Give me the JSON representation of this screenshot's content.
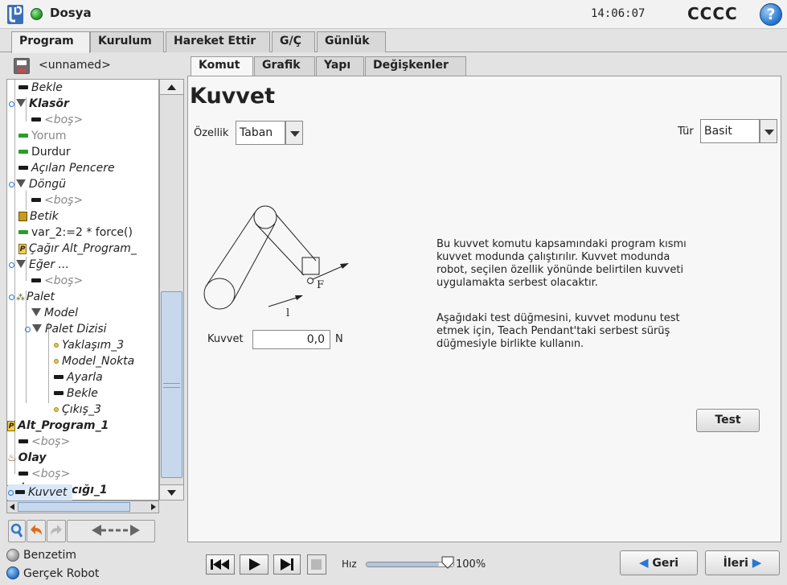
{
  "header": {
    "file_title": "Dosya",
    "clock": "14:06:07",
    "robot_name": "CCCC",
    "help": "?"
  },
  "main_tabs": [
    {
      "label": "Program"
    },
    {
      "label": "Kurulum"
    },
    {
      "label": "Hareket Ettir"
    },
    {
      "label": "G/Ç"
    },
    {
      "label": "Günlük"
    }
  ],
  "program_name": "<unnamed>",
  "tree": {
    "items": [
      {
        "label": "Bekle"
      },
      {
        "label": "Klasör"
      },
      {
        "label": "<boş>"
      },
      {
        "label": "Yorum"
      },
      {
        "label": "Durdur"
      },
      {
        "label": "Açılan Pencere"
      },
      {
        "label": "Döngü"
      },
      {
        "label": "<boş>"
      },
      {
        "label": "Betik"
      },
      {
        "label": "var_2:=2 * force()"
      },
      {
        "label": "Çağır Alt_Program_"
      },
      {
        "label": "Eğer ..."
      },
      {
        "label": "<boş>"
      },
      {
        "label": "Palet"
      },
      {
        "label": "Model"
      },
      {
        "label": "Palet Dizisi"
      },
      {
        "label": "Yaklaşım_3"
      },
      {
        "label": "Model_Nokta"
      },
      {
        "label": "Ayarla"
      },
      {
        "label": "Bekle"
      },
      {
        "label": "Çıkış_3"
      },
      {
        "label": "Alt_Program_1"
      },
      {
        "label": "<boş>"
      },
      {
        "label": "Olay"
      },
      {
        "label": "<boş>"
      },
      {
        "label": "İş_Parçacığı_1"
      },
      {
        "label": "Kuvvet"
      }
    ]
  },
  "sub_tabs": [
    {
      "label": "Komut"
    },
    {
      "label": "Grafik"
    },
    {
      "label": "Yapı"
    },
    {
      "label": "Değişkenler"
    }
  ],
  "command": {
    "title": "Kuvvet",
    "feature_label": "Özellik",
    "feature_value": "Taban",
    "type_label": "Tür",
    "type_value": "Basit",
    "force_label": "Kuvvet",
    "force_value": "0,0",
    "force_unit": "N",
    "diagram_label_f": "F",
    "diagram_label_l": "l",
    "desc_para1": [
      "Bu kuvvet komutu kapsamındaki program kısmı",
      "kuvvet modunda çalıştırılır. Kuvvet modunda",
      "robot, seçilen özellik yönünde belirtilen kuvveti",
      "uygulamakta serbest olacaktır."
    ],
    "desc_para2": [
      "Aşağıdaki test düğmesini, kuvvet modunu test",
      "etmek için, Teach Pendant'taki serbest sürüş",
      "düğmesiyle birlikte kullanın."
    ],
    "test_button": "Test"
  },
  "footer": {
    "sim_label": "Benzetim",
    "real_label": "Gerçek Robot",
    "speed_label": "Hız",
    "speed_value": "100%",
    "speed_fraction": 1.0,
    "back_button": "Geri",
    "next_button": "İleri"
  },
  "colors": {
    "accent": "#2a77d0",
    "status_green": "#2ea02e",
    "selection": "#d9e8f8"
  }
}
